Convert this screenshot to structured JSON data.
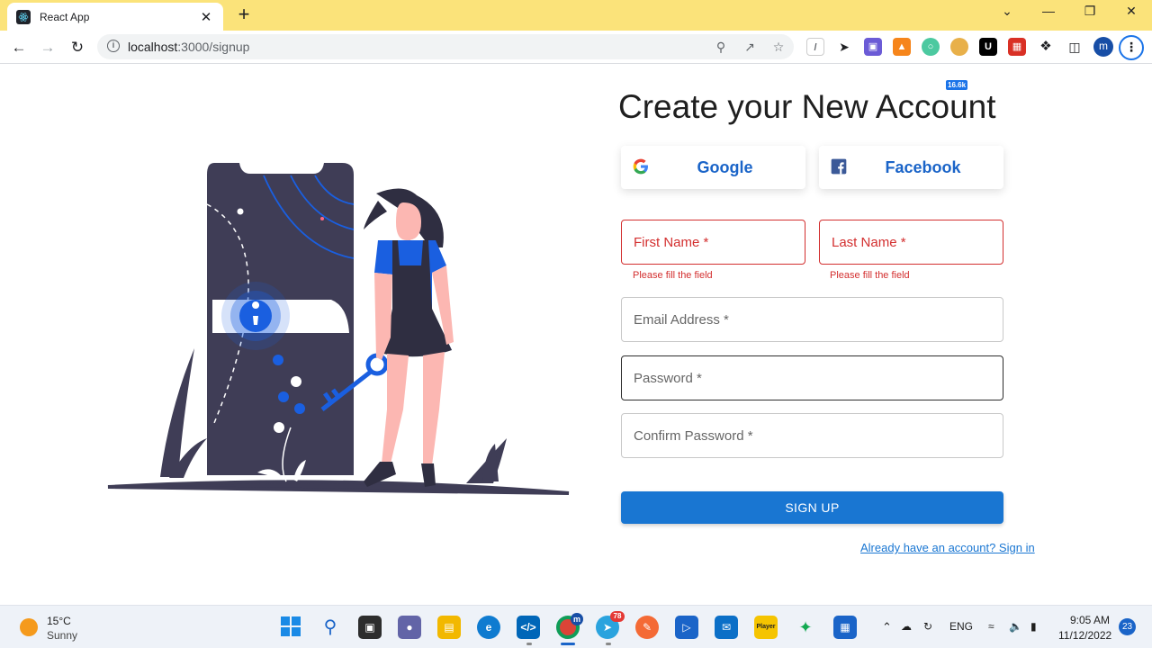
{
  "browser": {
    "tab_title": "React App",
    "tab_close": "✕",
    "new_tab": "+",
    "url_host": "localhost",
    "url_path": ":3000/signup",
    "extension_badge": "16.6k",
    "profile_initial": "m",
    "window_controls": [
      "⌄",
      "—",
      "❐",
      "✕"
    ]
  },
  "page": {
    "title": "Create your New Account",
    "social": {
      "google_label": "Google",
      "facebook_label": "Facebook"
    },
    "form": {
      "first_name": "First Name *",
      "last_name": "Last Name *",
      "first_name_error": "Please fill the field",
      "last_name_error": "Please fill the field",
      "email": "Email Address *",
      "password": "Password *",
      "confirm_password": "Confirm Password *",
      "submit_label": "SIGN UP",
      "signin_link": "Already have an account? Sign in"
    },
    "colors": {
      "primary": "#1976d2",
      "error": "#d32f2f",
      "illustration_dark": "#3f3d56",
      "illustration_accent": "#1a5fe0"
    }
  },
  "taskbar": {
    "weather_temp": "15°C",
    "weather_cond": "Sunny",
    "language": "ENG",
    "time": "9:05 AM",
    "date": "11/12/2022",
    "notification_count": "23",
    "telegram_badge": "78",
    "chrome_badge": "m",
    "apps": [
      "windows-start",
      "search",
      "task-view",
      "teams-chat",
      "file-explorer",
      "edge",
      "vscode",
      "chrome",
      "telegram",
      "postman",
      "zoom-like",
      "mail",
      "player",
      "mongodb",
      "store"
    ]
  }
}
